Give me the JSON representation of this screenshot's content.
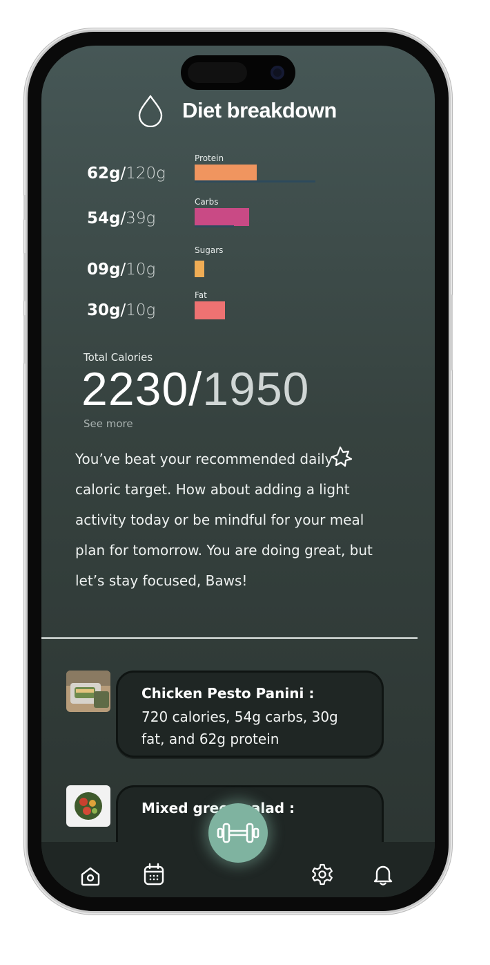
{
  "header": {
    "title": "Diet breakdown",
    "icon": "water-drop-icon"
  },
  "nutrients": [
    {
      "label": "Protein",
      "consumed": "62g",
      "goal": "120g",
      "color": "#f0955f",
      "fill_ratio": 0.52
    },
    {
      "label": "Carbs",
      "consumed": "54g",
      "goal": "39g",
      "color": "#c94a85",
      "fill_ratio": 1.38
    },
    {
      "label": "Sugars",
      "consumed": "09g",
      "goal": "10g",
      "color": "#f0ad55",
      "fill_ratio": 0.9
    },
    {
      "label": "Fat",
      "consumed": "30g",
      "goal": "10g",
      "color": "#ee7272",
      "fill_ratio": 3.0
    }
  ],
  "calories": {
    "label": "Total Calories",
    "consumed": "2230",
    "separator": "/",
    "goal": "1950",
    "see_more": "See more"
  },
  "message": "You’ve beat your recommended daily caloric target. How about adding a light activity today or be mindful for your meal plan for tomorrow.  You are doing great, but let’s stay focused, Baws!",
  "meals": [
    {
      "title": "Chicken Pesto Panini :",
      "description": "720 calories, 54g carbs, 30g fat, and 62g protein"
    },
    {
      "title": "Mixed green salad :",
      "description": ""
    }
  ],
  "nav": {
    "items": [
      "home-icon",
      "calendar-icon",
      "settings-icon",
      "bell-icon"
    ],
    "fab": "dumbbell-icon",
    "fab_color": "#7fb3a0"
  }
}
